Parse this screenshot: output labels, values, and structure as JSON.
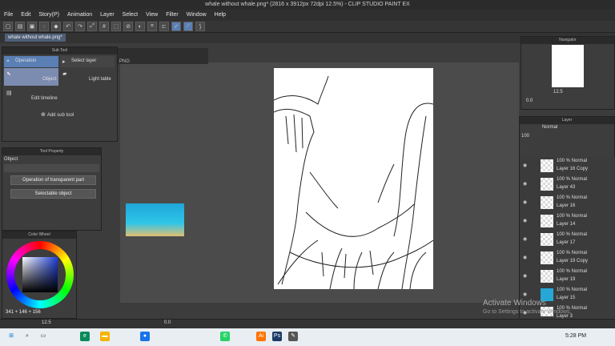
{
  "title": "whale without whale.png* (2816 x 3912px 72dpi 12.5%) - CLIP STUDIO PAINT EX",
  "menu": [
    "File",
    "Edit",
    "Story(P)",
    "Animation",
    "Layer",
    "Select",
    "View",
    "Filter",
    "Window",
    "Help"
  ],
  "doc_tab": "whale without whale.png*",
  "second_tab": "PNG",
  "subtool": {
    "title": "Sub Tool",
    "operation": "Operation",
    "select_layer": "Select layer",
    "object": "Object",
    "light_table": "Light table",
    "edit_timeline": "Edit timeline",
    "add_sub_tool": "Add sub tool"
  },
  "toolprop": {
    "title": "Tool Property",
    "object": "Object",
    "transparent": "Operation of transparent part",
    "selectable": "Selectable object"
  },
  "colorwheel": {
    "title": "Color Wheel",
    "values": "341 + 146 + 156"
  },
  "navigator": {
    "title": "Navigator",
    "zoom": "12.5",
    "angle": "0.0"
  },
  "layer": {
    "title": "Layer",
    "blend": "Normal",
    "opacity": "100",
    "rows": [
      {
        "mode": "100 % Normal",
        "name": "Layer 16 Copy"
      },
      {
        "mode": "100 % Normal",
        "name": "Layer 43"
      },
      {
        "mode": "100 % Normal",
        "name": "Layer 16"
      },
      {
        "mode": "100 % Normal",
        "name": "Layer 14"
      },
      {
        "mode": "100 % Normal",
        "name": "Layer 17"
      },
      {
        "mode": "100 % Normal",
        "name": "Layer 19 Copy"
      },
      {
        "mode": "100 % Normal",
        "name": "Layer 19"
      },
      {
        "mode": "100 % Normal",
        "name": "Layer 15"
      },
      {
        "mode": "100 % Normal",
        "name": "Layer 3"
      }
    ]
  },
  "status": {
    "zoom": "12.5",
    "angle": "0.0"
  },
  "watermark": {
    "line1": "Activate Windows",
    "line2": "Go to Settings to activate Windows."
  },
  "taskbar": {
    "time": "5:28 PM"
  }
}
